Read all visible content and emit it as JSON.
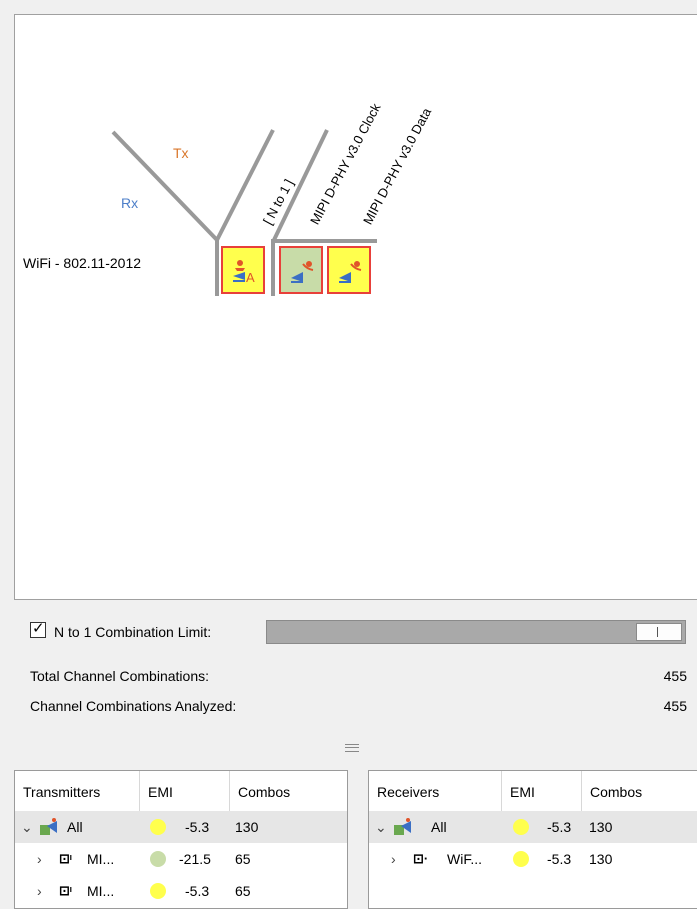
{
  "diagram": {
    "receiver_label": "WiFi - 802.11-2012",
    "rx_label": "Rx",
    "tx_label": "Tx",
    "column_labels": [
      "[ N to 1 ]",
      "MIPI D-PHY v3.0 Clock",
      "MIPI D-PHY v3.0 Data"
    ],
    "cells": [
      {
        "icon": "n-to-1-icon",
        "badge": "A",
        "fill": "#ffff4d"
      },
      {
        "icon": "transmitter-icon",
        "fill": "#c8dca8"
      },
      {
        "icon": "transmitter-icon",
        "fill": "#ffff4d"
      }
    ],
    "colors": {
      "rx": "#4d7fc9",
      "tx": "#d9762a",
      "line": "#999999",
      "cell_border": "#e8403a"
    }
  },
  "limit": {
    "label": "N to 1 Combination Limit:",
    "checked": "☑",
    "level": 1.0
  },
  "stats": {
    "total_label": "Total Channel Combinations:",
    "total_value": "455",
    "analyzed_label": "Channel Combinations Analyzed:",
    "analyzed_value": "455"
  },
  "transmitters": {
    "headers": [
      "Transmitters",
      "EMI",
      "Combos"
    ],
    "rows": [
      {
        "chevron": "⌄",
        "name": "All",
        "emi": "-5.3",
        "combos": "130",
        "dot": "#ffff4d"
      },
      {
        "chevron": "›",
        "name": "MI...",
        "emi": "-21.5",
        "combos": "65",
        "dot": "#c8dca8"
      },
      {
        "chevron": "›",
        "name": "MI...",
        "emi": "-5.3",
        "combos": "65",
        "dot": "#ffff4d"
      }
    ]
  },
  "receivers": {
    "headers": [
      "Receivers",
      "EMI",
      "Combos"
    ],
    "rows": [
      {
        "chevron": "⌄",
        "name": "All",
        "emi": "-5.3",
        "combos": "130",
        "dot": "#ffff4d"
      },
      {
        "chevron": "›",
        "name": "WiF...",
        "emi": "-5.3",
        "combos": "130",
        "dot": "#ffff4d"
      }
    ]
  }
}
